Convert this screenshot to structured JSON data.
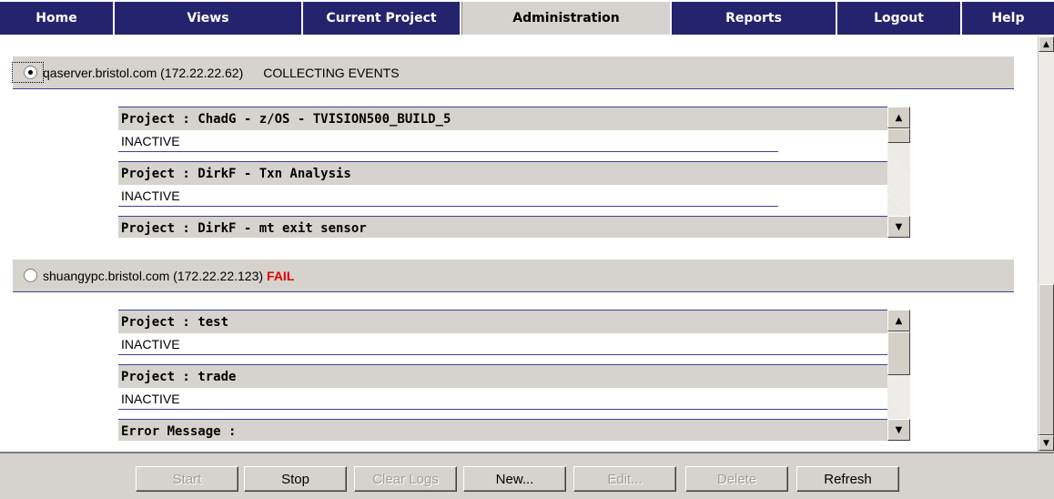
{
  "nav": {
    "tabs": [
      {
        "label": "Home"
      },
      {
        "label": "Views"
      },
      {
        "label": "Current Project"
      },
      {
        "label": "Administration",
        "active": true
      },
      {
        "label": "Reports"
      },
      {
        "label": "Logout"
      },
      {
        "label": "Help"
      }
    ]
  },
  "servers": [
    {
      "name": "qaserver.bristol.com (172.22.22.62)",
      "status": "COLLECTING EVENTS",
      "selected": true,
      "projects": [
        {
          "header": "Project : ChadG - z/OS - TVISION500_BUILD_5",
          "status": "INACTIVE"
        },
        {
          "header": "Project : DirkF - Txn Analysis",
          "status": "INACTIVE"
        },
        {
          "header": "Project : DirkF - mt exit sensor"
        }
      ]
    },
    {
      "name": "shuangypc.bristol.com (172.22.22.123)",
      "status": "FAIL",
      "selected": false,
      "projects": [
        {
          "header": "Project : test",
          "status": "INACTIVE"
        },
        {
          "header": "Project : trade",
          "status": "INACTIVE"
        },
        {
          "header": "Error Message :"
        }
      ]
    }
  ],
  "footer": {
    "start": "Start",
    "stop": "Stop",
    "clear_logs": "Clear Logs",
    "new": "New...",
    "edit": "Edit...",
    "delete": "Delete",
    "refresh": "Refresh"
  }
}
